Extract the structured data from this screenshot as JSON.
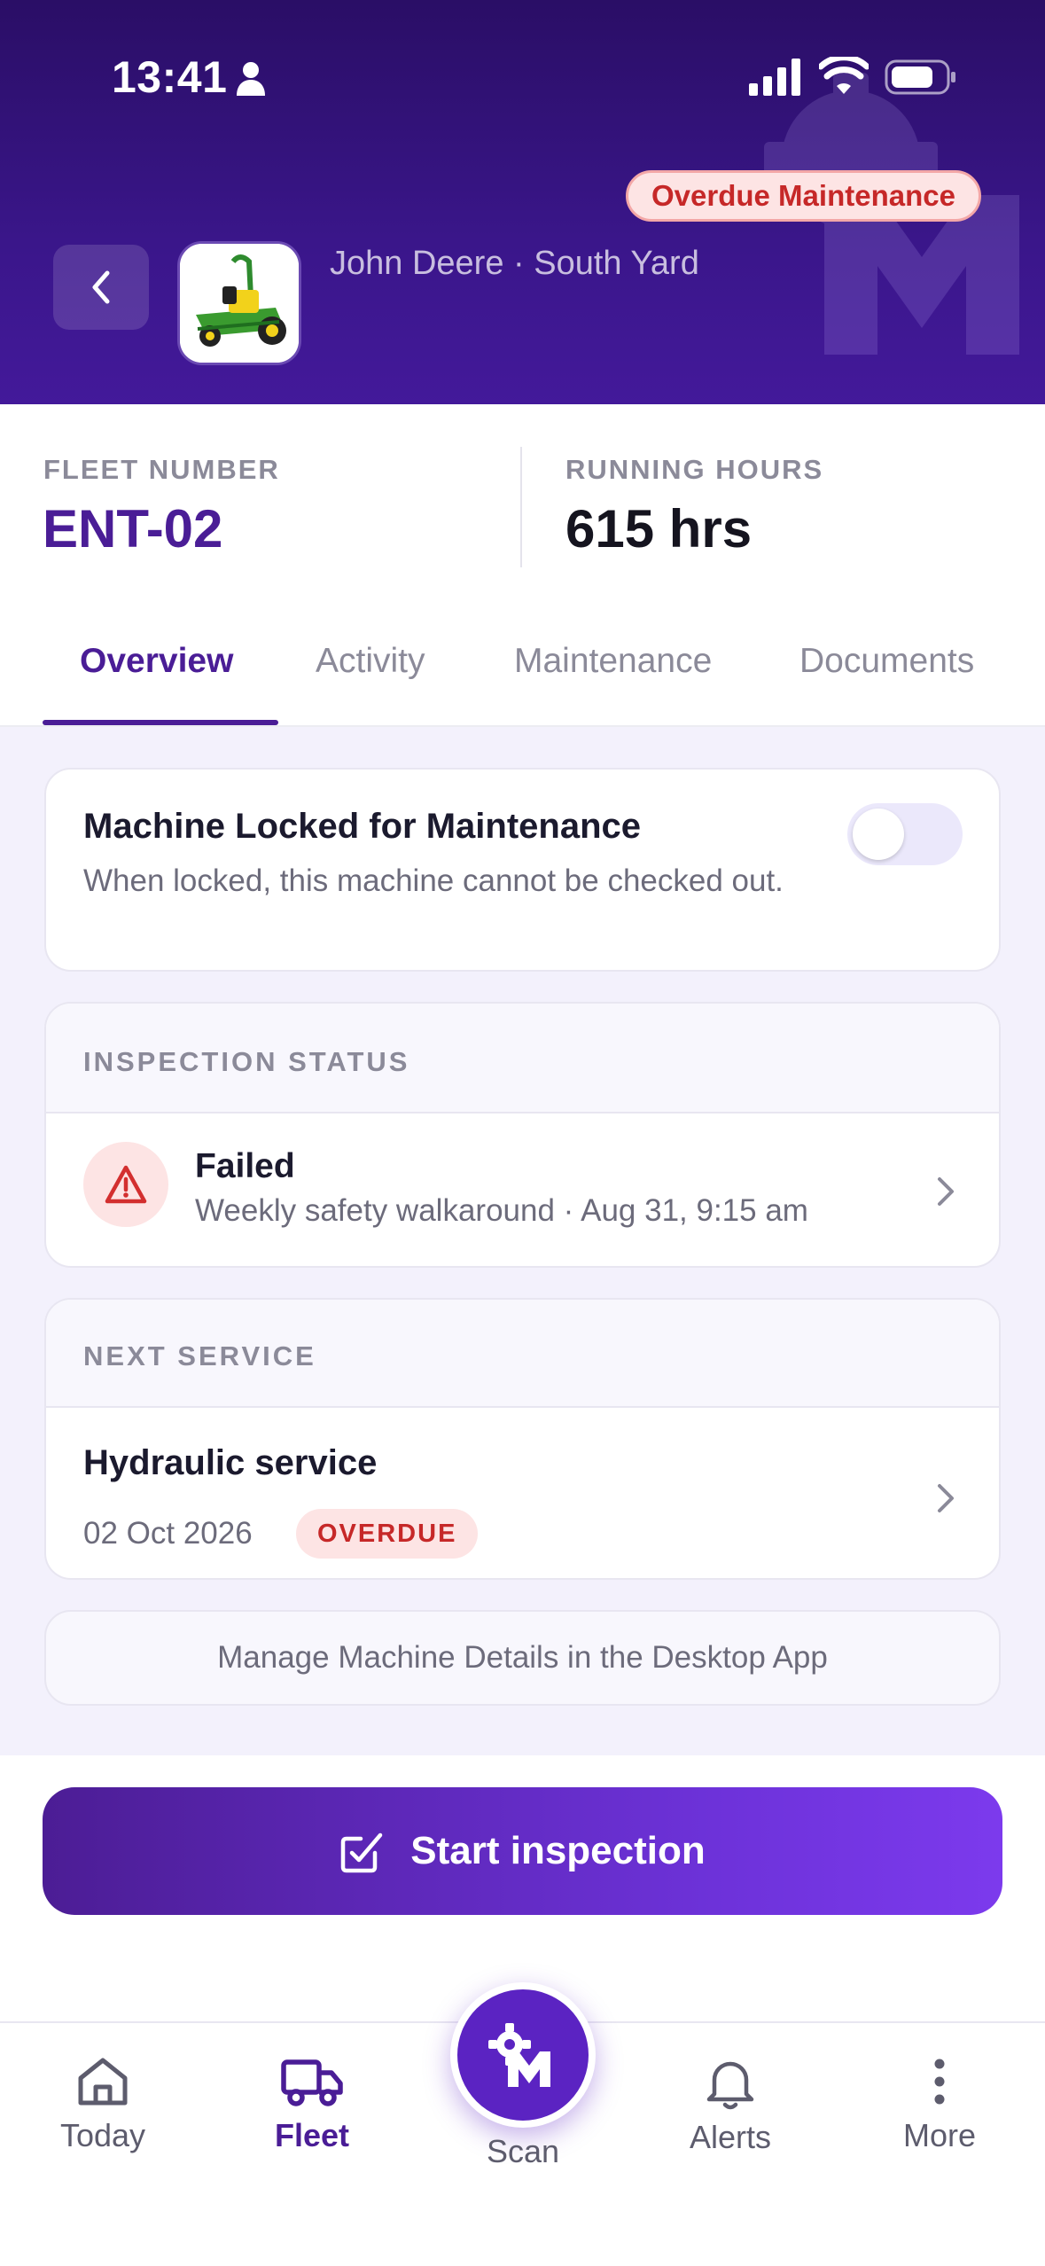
{
  "status_bar": {
    "time": "13:41"
  },
  "header": {
    "badge": "Overdue Maintenance",
    "subtitle": "John Deere · South Yard"
  },
  "stats": {
    "fleet_number_label": "FLEET NUMBER",
    "fleet_number_value": "ENT-02",
    "running_hours_label": "RUNNING HOURS",
    "running_hours_value": "615 hrs"
  },
  "tabs": [
    {
      "label": "Overview",
      "active": true
    },
    {
      "label": "Activity",
      "active": false
    },
    {
      "label": "Maintenance",
      "active": false
    },
    {
      "label": "Documents",
      "active": false
    }
  ],
  "lock_card": {
    "title": "Machine Locked for Maintenance",
    "description": "When locked, this machine cannot be checked out.",
    "toggle_on": false
  },
  "inspection": {
    "section_label": "INSPECTION STATUS",
    "status": "Failed",
    "detail": "Weekly safety walkaround · Aug 31, 9:15 am"
  },
  "next_service": {
    "section_label": "NEXT SERVICE",
    "title": "Hydraulic service",
    "date": "02 Oct 2026",
    "badge": "OVERDUE"
  },
  "desktop_note": "Manage Machine Details in the Desktop App",
  "cta": {
    "label": "Start inspection"
  },
  "nav": {
    "items": [
      {
        "label": "Today",
        "icon": "home-icon"
      },
      {
        "label": "Fleet",
        "icon": "truck-icon",
        "active": true
      },
      {
        "label": "Scan",
        "icon": "scan-logo-icon"
      },
      {
        "label": "Alerts",
        "icon": "bell-icon"
      },
      {
        "label": "More",
        "icon": "more-vertical-icon"
      }
    ]
  },
  "colors": {
    "brand": "#4a1d96",
    "header": "#2a0e66",
    "danger": "#c62828",
    "surface": "#f3f1fc"
  }
}
